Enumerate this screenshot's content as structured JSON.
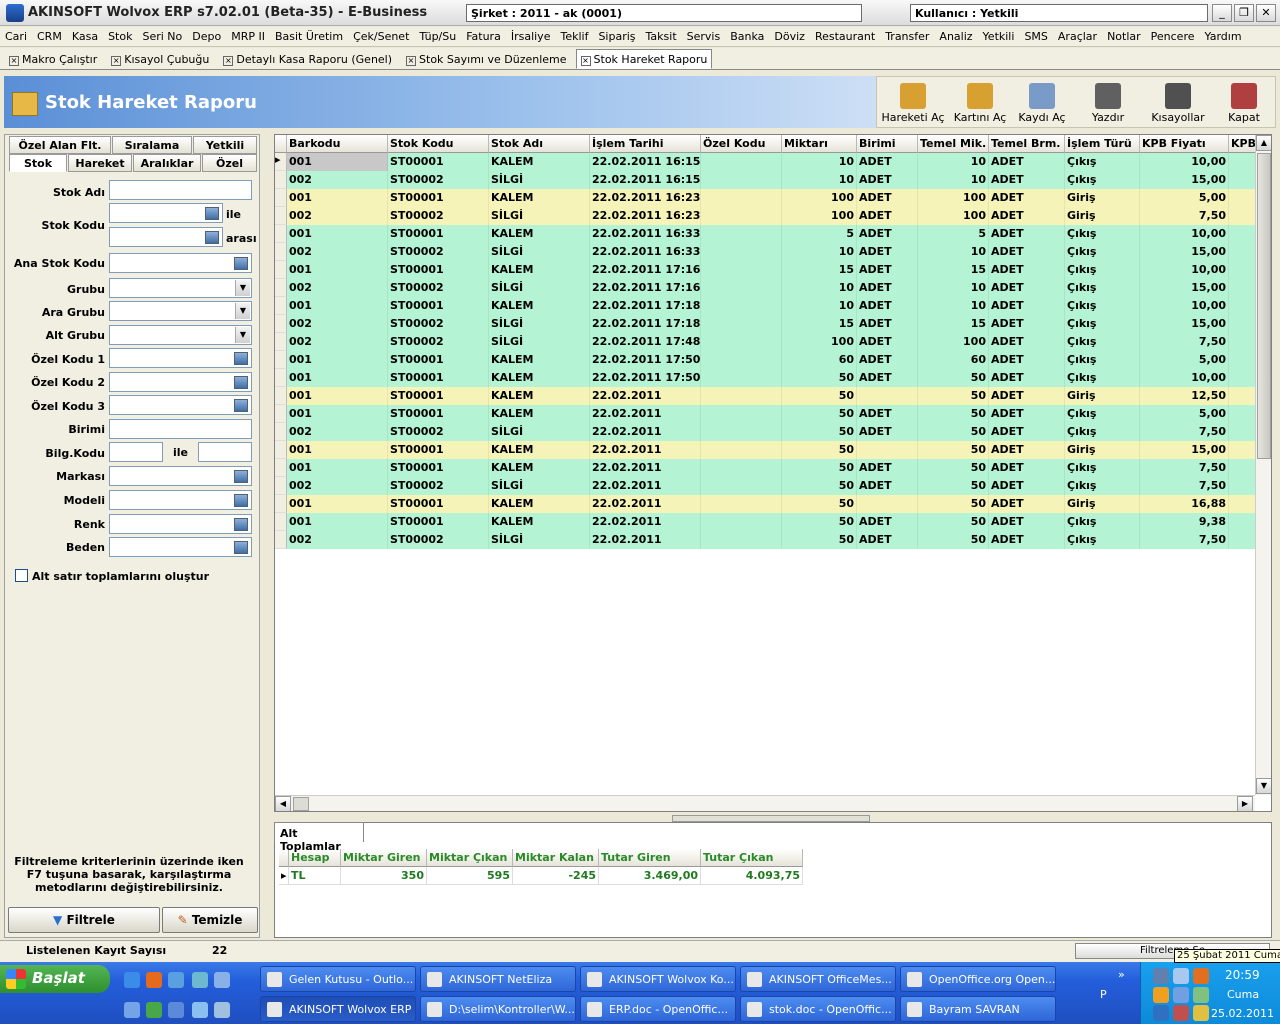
{
  "window": {
    "title": "AKINSOFT Wolvox ERP s7.02.01 (Beta-35) - E-Business",
    "company": "Şirket : 2011 - ak (0001)",
    "user": "Kullanıcı : Yetkili"
  },
  "menu": [
    "Cari",
    "CRM",
    "Kasa",
    "Stok",
    "Seri No",
    "Depo",
    "MRP II",
    "Basit Üretim",
    "Çek/Senet",
    "Tüp/Su",
    "Fatura",
    "İrsaliye",
    "Teklif",
    "Sipariş",
    "Taksit",
    "Servis",
    "Banka",
    "Döviz",
    "Restaurant",
    "Transfer",
    "Analiz",
    "Yetkili",
    "SMS",
    "Araçlar",
    "Notlar",
    "Pencere",
    "Yardım"
  ],
  "doc_tabs": [
    "Makro Çalıştır",
    "Kısayol Çubuğu",
    "Detaylı Kasa Raporu (Genel)",
    "Stok Sayımı ve Düzenleme",
    "Stok Hareket Raporu"
  ],
  "report_title": "Stok Hareket Raporu",
  "toolbar": [
    "Hareketi Aç",
    "Kartını Aç",
    "Kaydı Aç",
    "Yazdır",
    "Kısayollar",
    "Kapat"
  ],
  "filter_tabs_top": [
    "Özel Alan Flt.",
    "Sıralama",
    "Yetkili"
  ],
  "filter_tabs_bottom": [
    "Stok",
    "Hareket",
    "Aralıklar",
    "Özel"
  ],
  "filter": {
    "stok_adi": "Stok Adı",
    "stok_kodu": "Stok Kodu",
    "ile": "ile",
    "arasi": "arası",
    "ana_stok_kodu": "Ana Stok Kodu",
    "grubu": "Grubu",
    "ara_grubu": "Ara Grubu",
    "alt_grubu": "Alt Grubu",
    "ozel1": "Özel Kodu 1",
    "ozel2": "Özel Kodu 2",
    "ozel3": "Özel Kodu 3",
    "birimi": "Birimi",
    "bilg_kodu": "Bilg.Kodu",
    "bilg_ile": "ile",
    "markasi": "Markası",
    "modeli": "Modeli",
    "renk": "Renk",
    "beden": "Beden",
    "alt_satir": "Alt satır toplamlarını oluştur",
    "hint": "Filtreleme kriterlerinin üzerinde iken F7 tuşuna basarak, karşılaştırma metodlarını değiştirebilirsiniz.",
    "filtrele": "Filtrele",
    "temizle": "Temizle"
  },
  "grid": {
    "columns": [
      "Barkodu",
      "Stok Kodu",
      "Stok Adı",
      "İşlem Tarihi",
      "Özel Kodu",
      "Miktarı",
      "Birimi",
      "Temel Mik.",
      "Temel Brm.",
      "İşlem Türü",
      "KPB Fiyatı",
      "KPB"
    ],
    "rows": [
      {
        "c": "green",
        "v": [
          "001",
          "ST00001",
          "KALEM",
          "22.02.2011 16:15:18",
          "",
          "10",
          "ADET",
          "10",
          "ADET",
          "Çıkış",
          "10,00"
        ]
      },
      {
        "c": "green",
        "v": [
          "002",
          "ST00002",
          "SİLGİ",
          "22.02.2011 16:15:18",
          "",
          "10",
          "ADET",
          "10",
          "ADET",
          "Çıkış",
          "15,00"
        ]
      },
      {
        "c": "yellow",
        "v": [
          "001",
          "ST00001",
          "KALEM",
          "22.02.2011 16:23:14",
          "",
          "100",
          "ADET",
          "100",
          "ADET",
          "Giriş",
          "5,00"
        ]
      },
      {
        "c": "yellow",
        "v": [
          "002",
          "ST00002",
          "SİLGİ",
          "22.02.2011 16:23:14",
          "",
          "100",
          "ADET",
          "100",
          "ADET",
          "Giriş",
          "7,50"
        ]
      },
      {
        "c": "green",
        "v": [
          "001",
          "ST00001",
          "KALEM",
          "22.02.2011 16:33:47",
          "",
          "5",
          "ADET",
          "5",
          "ADET",
          "Çıkış",
          "10,00"
        ]
      },
      {
        "c": "green",
        "v": [
          "002",
          "ST00002",
          "SİLGİ",
          "22.02.2011 16:33:47",
          "",
          "10",
          "ADET",
          "10",
          "ADET",
          "Çıkış",
          "15,00"
        ]
      },
      {
        "c": "green",
        "v": [
          "001",
          "ST00001",
          "KALEM",
          "22.02.2011 17:16:40",
          "",
          "15",
          "ADET",
          "15",
          "ADET",
          "Çıkış",
          "10,00"
        ]
      },
      {
        "c": "green",
        "v": [
          "002",
          "ST00002",
          "SİLGİ",
          "22.02.2011 17:16:40",
          "",
          "10",
          "ADET",
          "10",
          "ADET",
          "Çıkış",
          "15,00"
        ]
      },
      {
        "c": "green",
        "v": [
          "001",
          "ST00001",
          "KALEM",
          "22.02.2011 17:18:18",
          "",
          "10",
          "ADET",
          "10",
          "ADET",
          "Çıkış",
          "10,00"
        ]
      },
      {
        "c": "green",
        "v": [
          "002",
          "ST00002",
          "SİLGİ",
          "22.02.2011 17:18:18",
          "",
          "15",
          "ADET",
          "15",
          "ADET",
          "Çıkış",
          "15,00"
        ]
      },
      {
        "c": "green",
        "v": [
          "002",
          "ST00002",
          "SİLGİ",
          "22.02.2011 17:48:14",
          "",
          "100",
          "ADET",
          "100",
          "ADET",
          "Çıkış",
          "7,50"
        ]
      },
      {
        "c": "green",
        "v": [
          "001",
          "ST00001",
          "KALEM",
          "22.02.2011 17:50:10",
          "",
          "60",
          "ADET",
          "60",
          "ADET",
          "Çıkış",
          "5,00"
        ]
      },
      {
        "c": "green",
        "v": [
          "001",
          "ST00001",
          "KALEM",
          "22.02.2011 17:50:58",
          "",
          "50",
          "ADET",
          "50",
          "ADET",
          "Çıkış",
          "10,00"
        ]
      },
      {
        "c": "yellow",
        "v": [
          "001",
          "ST00001",
          "KALEM",
          "22.02.2011",
          "",
          "50",
          "",
          "50",
          "ADET",
          "Giriş",
          "12,50"
        ]
      },
      {
        "c": "green",
        "v": [
          "001",
          "ST00001",
          "KALEM",
          "22.02.2011",
          "",
          "50",
          "ADET",
          "50",
          "ADET",
          "Çıkış",
          "5,00"
        ]
      },
      {
        "c": "green",
        "v": [
          "002",
          "ST00002",
          "SİLGİ",
          "22.02.2011",
          "",
          "50",
          "ADET",
          "50",
          "ADET",
          "Çıkış",
          "7,50"
        ]
      },
      {
        "c": "yellow",
        "v": [
          "001",
          "ST00001",
          "KALEM",
          "22.02.2011",
          "",
          "50",
          "",
          "50",
          "ADET",
          "Giriş",
          "15,00"
        ]
      },
      {
        "c": "green",
        "v": [
          "001",
          "ST00001",
          "KALEM",
          "22.02.2011",
          "",
          "50",
          "ADET",
          "50",
          "ADET",
          "Çıkış",
          "7,50"
        ]
      },
      {
        "c": "green",
        "v": [
          "002",
          "ST00002",
          "SİLGİ",
          "22.02.2011",
          "",
          "50",
          "ADET",
          "50",
          "ADET",
          "Çıkış",
          "7,50"
        ]
      },
      {
        "c": "yellow",
        "v": [
          "001",
          "ST00001",
          "KALEM",
          "22.02.2011",
          "",
          "50",
          "",
          "50",
          "ADET",
          "Giriş",
          "16,88"
        ]
      },
      {
        "c": "green",
        "v": [
          "001",
          "ST00001",
          "KALEM",
          "22.02.2011",
          "",
          "50",
          "ADET",
          "50",
          "ADET",
          "Çıkış",
          "9,38"
        ]
      },
      {
        "c": "green",
        "v": [
          "002",
          "ST00002",
          "SİLGİ",
          "22.02.2011",
          "",
          "50",
          "ADET",
          "50",
          "ADET",
          "Çıkış",
          "7,50"
        ]
      }
    ]
  },
  "totals": {
    "tab": "Alt Toplamlar",
    "columns": [
      "Hesap",
      "Miktar Giren",
      "Miktar Çıkan",
      "Miktar Kalan",
      "Tutar Giren",
      "Tutar Çıkan"
    ],
    "row": [
      "TL",
      "350",
      "595",
      "-245",
      "3.469,00",
      "4.093,75"
    ]
  },
  "status": {
    "label": "Listelenen Kayıt Sayısı",
    "count": "22",
    "right": "Filtreleme Se"
  },
  "taskbar": {
    "start": "Başlat",
    "row1": [
      "Gelen Kutusu - Outlo...",
      "AKINSOFT NetEliza",
      "AKINSOFT Wolvox Ko...",
      "AKINSOFT OfficeMes...",
      "OpenOffice.org Open..."
    ],
    "row2": [
      "AKINSOFT Wolvox ERP",
      "D:\\selim\\Kontroller\\W...",
      "ERP.doc - OpenOffic...",
      "stok.doc - OpenOffic...",
      "Bayram SAVRAN"
    ],
    "lang": "P",
    "tooltip": "25 Şubat 2011 Cuma",
    "time": "20:59",
    "day": "Cuma",
    "date": "25.02.2011"
  },
  "colors": {
    "row_green": "#b4f3d3",
    "row_yellow": "#f6f3b8",
    "banner": "#5a8fd6",
    "taskbar": "#245edb"
  }
}
